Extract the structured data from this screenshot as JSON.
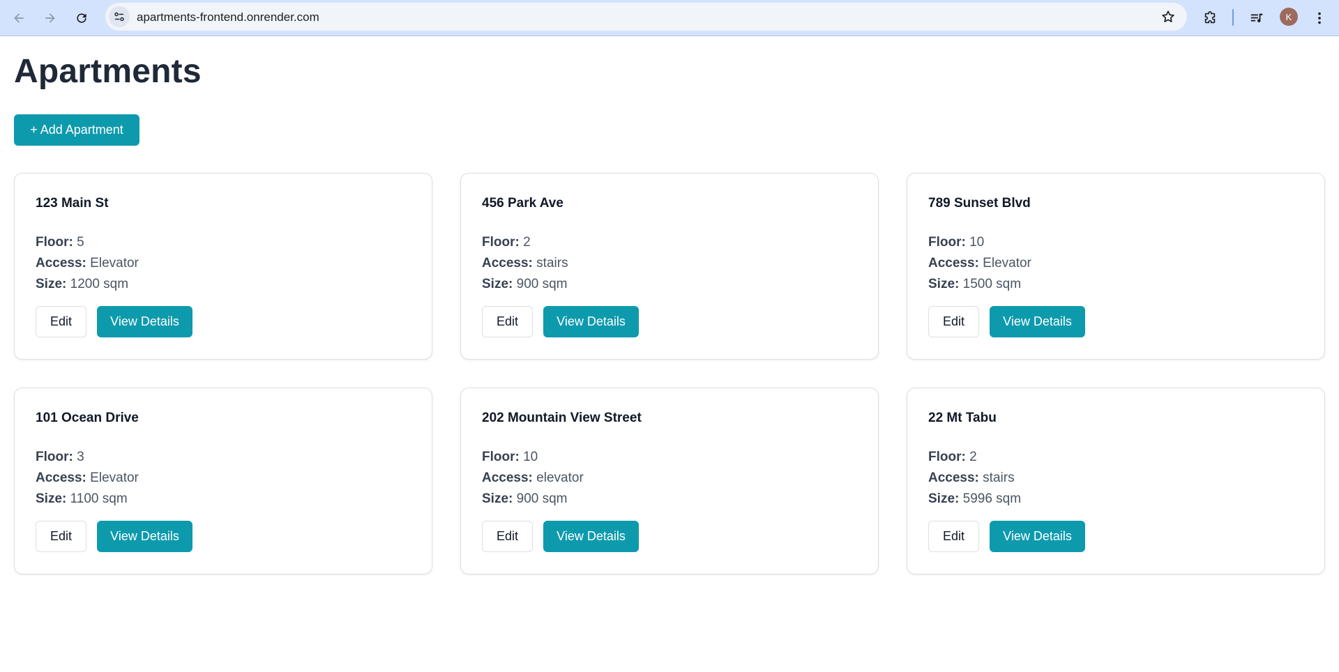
{
  "browser": {
    "url": "apartments-frontend.onrender.com",
    "profile_initial": "K"
  },
  "page": {
    "title": "Apartments",
    "add_button_label": "+ Add Apartment"
  },
  "labels": {
    "floor": "Floor:",
    "access": "Access:",
    "size": "Size:",
    "edit": "Edit",
    "view_details": "View Details"
  },
  "apartments": [
    {
      "address": "123 Main St",
      "floor": "5",
      "access": "Elevator",
      "size": "1200 sqm"
    },
    {
      "address": "456 Park Ave",
      "floor": "2",
      "access": "stairs",
      "size": "900 sqm"
    },
    {
      "address": "789 Sunset Blvd",
      "floor": "10",
      "access": "Elevator",
      "size": "1500 sqm"
    },
    {
      "address": "101 Ocean Drive",
      "floor": "3",
      "access": "Elevator",
      "size": "1100 sqm"
    },
    {
      "address": "202 Mountain View Street",
      "floor": "10",
      "access": "elevator",
      "size": "900 sqm"
    },
    {
      "address": "22 Mt Tabu",
      "floor": "2",
      "access": "stairs",
      "size": "5996 sqm"
    }
  ],
  "colors": {
    "primary": "#0e9aad",
    "chrome": "#d3e3fd",
    "heading": "#1f2937"
  }
}
